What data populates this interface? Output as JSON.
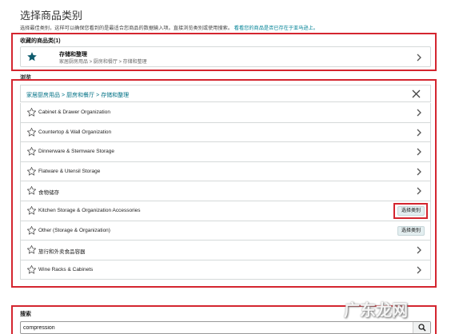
{
  "header": {
    "title": "选择商品类别",
    "intro_text": "选择最佳类别，这样可以确保您看到的是最适合您商品的数据输入项。直接浏览类别或使用搜索。",
    "intro_link": "看看您的商品是否已存在于亚马逊上。"
  },
  "favorites": {
    "label": "收藏的商品类(1)",
    "item": {
      "name": "存储和整理",
      "path": "家居厨房用品 > 厨房和餐厅 > 存储和整理"
    }
  },
  "browse": {
    "label": "浏览",
    "breadcrumb": [
      "家居厨房用品",
      "厨房和餐厅",
      "存储和整理"
    ],
    "items": [
      {
        "label": "Cabinet & Drawer Organization",
        "action": "chevron"
      },
      {
        "label": "Countertop & Wall Organization",
        "action": "chevron"
      },
      {
        "label": "Dinnerware & Stemware Storage",
        "action": "chevron"
      },
      {
        "label": "Flatware & Utensil Storage",
        "action": "chevron"
      },
      {
        "label": "食物储存",
        "action": "chevron"
      },
      {
        "label": "Kitchen Storage & Organization Accessories",
        "action": "select",
        "button": "选择类别"
      },
      {
        "label": "Other (Storage & Organization)",
        "action": "select",
        "button": "选择类别"
      },
      {
        "label": "旅行和外卖食品容器",
        "action": "chevron"
      },
      {
        "label": "Wine Racks & Cabinets",
        "action": "chevron"
      }
    ]
  },
  "search": {
    "label": "搜索",
    "value": "compression"
  },
  "watermark": "广东龙网",
  "colors": {
    "highlight_border": "#d4252f",
    "link": "#007185",
    "select_button": "#e3eef0"
  }
}
